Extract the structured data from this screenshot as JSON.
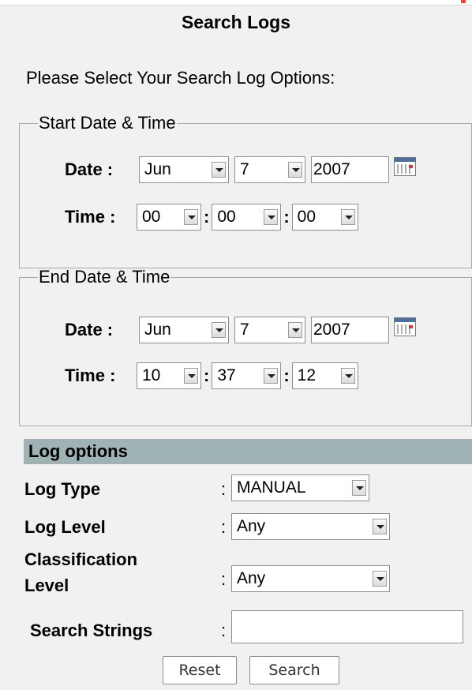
{
  "title": "Search Logs",
  "instruction": "Please Select Your Search Log Options:",
  "start": {
    "legend": "Start Date & Time",
    "date_label": "Date :",
    "time_label": "Time :",
    "month": "Jun",
    "day": "7",
    "year": "2007",
    "hour": "00",
    "minute": "00",
    "second": "00"
  },
  "end": {
    "legend": "End Date & Time",
    "date_label": "Date :",
    "time_label": "Time :",
    "month": "Jun",
    "day": "7",
    "year": "2007",
    "hour": "10",
    "minute": "37",
    "second": "12"
  },
  "time_separator": ":",
  "log_options": {
    "header": "Log options",
    "separator": ":",
    "log_type_label": "Log Type",
    "log_type_value": "MANUAL",
    "log_level_label": "Log Level",
    "log_level_value": "Any",
    "classification_label_line1": "Classification",
    "classification_label_line2": "Level",
    "classification_value": "Any",
    "search_strings_label": "Search Strings",
    "search_strings_value": ""
  },
  "buttons": {
    "reset": "Reset",
    "search": "Search"
  },
  "icons": {
    "calendar": "calendar-icon",
    "dropdown": "chevron-down-icon"
  },
  "colors": {
    "header_bar": "#9fb3b5",
    "background": "#f1f1f1"
  }
}
